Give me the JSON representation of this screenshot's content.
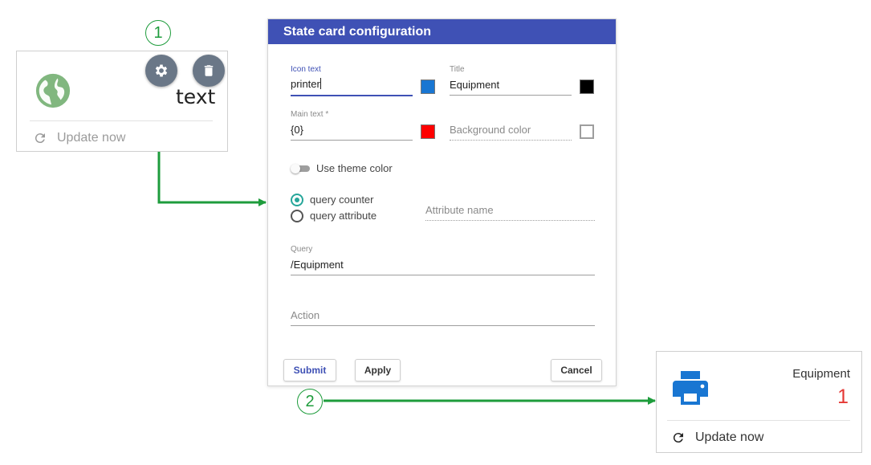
{
  "callouts": {
    "one": "1",
    "two": "2"
  },
  "widget_before": {
    "main_text": "text",
    "update_label": "Update now",
    "icon_color": "#81b77f",
    "action_button_color": "#6a7787"
  },
  "dialog": {
    "title": "State card configuration",
    "header_color": "#3f51b5",
    "icon_text": {
      "label": "Icon text",
      "value": "printer",
      "color": "#1976d2"
    },
    "title_field": {
      "label": "Title",
      "value": "Equipment",
      "color": "#000000"
    },
    "main_text": {
      "label": "Main text *",
      "value": "{0}",
      "color": "#ff0000"
    },
    "background_color": {
      "placeholder": "Background color",
      "color": "#ffffff"
    },
    "use_theme_color": {
      "label": "Use theme color",
      "checked": false
    },
    "query_type": {
      "options": [
        "query counter",
        "query attribute"
      ],
      "selected": "query counter"
    },
    "attribute_name": {
      "placeholder": "Attribute name"
    },
    "query": {
      "label": "Query",
      "value": "/Equipment"
    },
    "action": {
      "placeholder": "Action"
    },
    "buttons": {
      "submit": "Submit",
      "apply": "Apply",
      "cancel": "Cancel"
    }
  },
  "widget_after": {
    "title": "Equipment",
    "count": "1",
    "update_label": "Update now",
    "icon": "printer-icon",
    "icon_color": "#1976d2",
    "count_color": "#e53935"
  },
  "connector_color": "#1e9c3c"
}
